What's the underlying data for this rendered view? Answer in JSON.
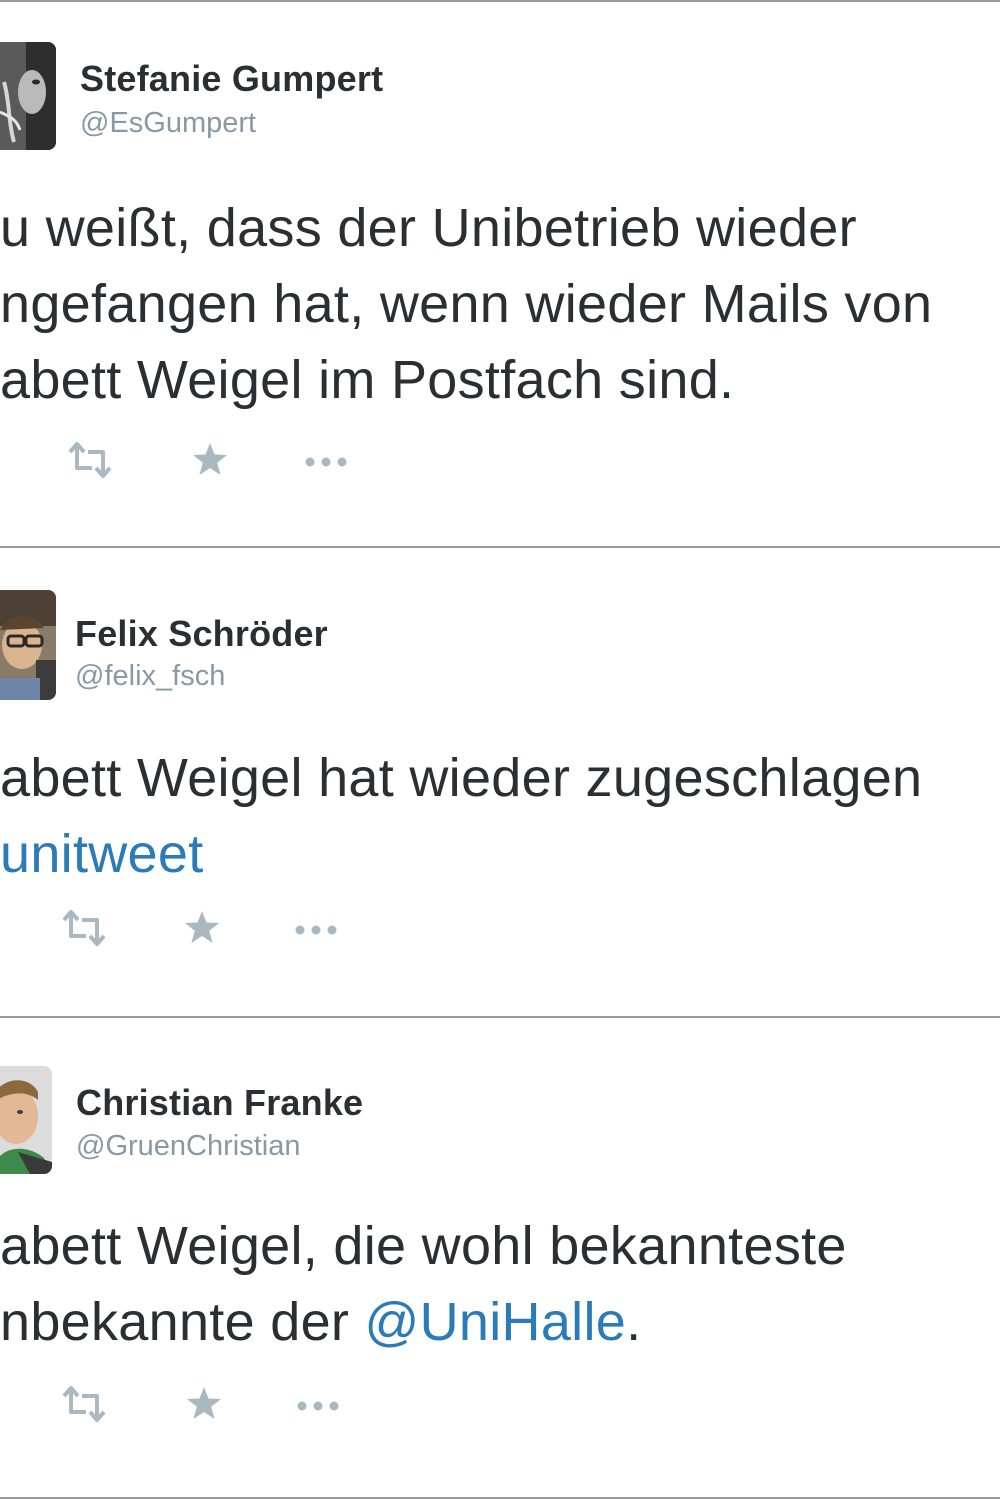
{
  "tweets": [
    {
      "name": "Stefanie Gumpert",
      "handle": "@EsGumpert",
      "lines": [
        [
          {
            "t": "u weißt, dass der Unibetrieb wieder"
          }
        ],
        [
          {
            "t": "ngefangen hat, wenn wieder Mails von"
          }
        ],
        [
          {
            "t": "abett Weigel im Postfach sind."
          }
        ]
      ],
      "actions": {
        "retweet": "retweet-icon",
        "favorite": "star-icon",
        "more": "more-dots-icon"
      }
    },
    {
      "name": "Felix Schröder",
      "handle": "@felix_fsch",
      "lines": [
        [
          {
            "t": "abett Weigel hat wieder zugeschlagen"
          }
        ],
        [
          {
            "t": "unitweet",
            "link": true
          }
        ]
      ],
      "actions": {
        "retweet": "retweet-icon",
        "favorite": "star-icon",
        "more": "more-dots-icon"
      }
    },
    {
      "name": "Christian Franke",
      "handle": "@GruenChristian",
      "lines": [
        [
          {
            "t": "abett Weigel, die wohl bekannteste"
          }
        ],
        [
          {
            "t": "nbekannte der "
          },
          {
            "t": "@UniHalle",
            "link": true
          },
          {
            "t": "."
          }
        ]
      ],
      "actions": {
        "retweet": "retweet-icon",
        "favorite": "star-icon",
        "more": "more-dots-icon"
      }
    }
  ],
  "colors": {
    "text": "#292f33",
    "handle": "#8899a6",
    "link": "#2b7bb9",
    "action_icon": "#aab8c2",
    "divider": "#9a9a9a"
  }
}
